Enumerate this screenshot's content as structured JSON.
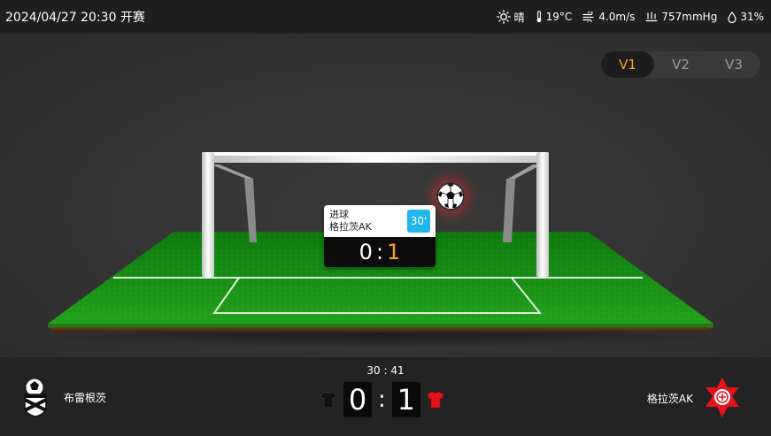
{
  "header": {
    "datetime": "2024/04/27 20:30 开赛",
    "weather": {
      "condition": "晴",
      "temperature": "19°C",
      "wind": "4.0m/s",
      "pressure": "757mmHg",
      "humidity": "31%"
    }
  },
  "view_tabs": [
    {
      "label": "V1",
      "active": true
    },
    {
      "label": "V2",
      "active": false
    },
    {
      "label": "V3",
      "active": false
    }
  ],
  "event_card": {
    "type": "进球",
    "team": "格拉茨AK",
    "minute": "30'",
    "home_score": "0",
    "separator": ":",
    "away_score": "1"
  },
  "match": {
    "clock": "30 : 41",
    "home_team": "布雷根茨",
    "away_team": "格拉茨AK",
    "home_score": "0",
    "separator": ":",
    "away_score": "1",
    "home_kit_color": "#111111",
    "away_kit_color": "#e8121b"
  },
  "colors": {
    "accent": "#f5a623",
    "minute_badge": "#1fb6ee",
    "pitch": "#1f9a1a"
  },
  "icons": {
    "weather": "sun-icon",
    "temperature": "thermometer-icon",
    "wind": "wind-icon",
    "pressure": "pressure-icon",
    "humidity": "droplet-icon",
    "ball": "soccer-ball-icon"
  }
}
